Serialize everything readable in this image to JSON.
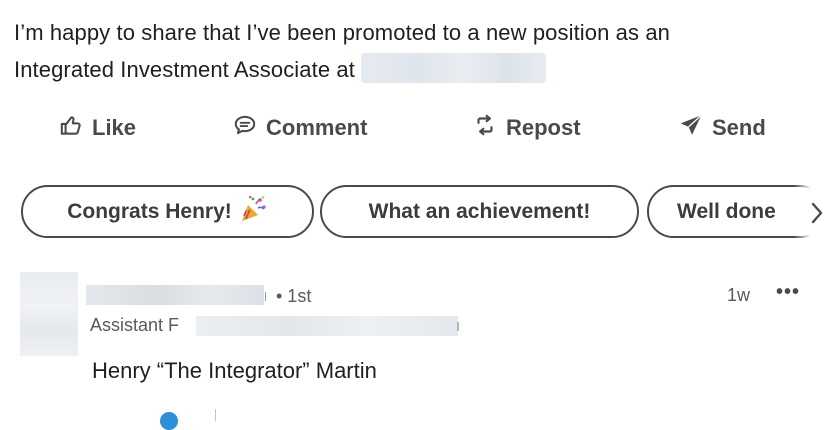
{
  "post": {
    "text_line_1": "I’m happy to share that I’ve been promoted to a new position as an",
    "text_line_2": "Integrated Investment Associate at"
  },
  "actions": {
    "like": "Like",
    "comment": "Comment",
    "repost": "Repost",
    "send": "Send"
  },
  "suggested_replies": [
    {
      "label": "Congrats Henry!",
      "icon": "party-popper-icon"
    },
    {
      "label": "What an achievement!"
    },
    {
      "label": "Well done"
    }
  ],
  "comment": {
    "degree": "• 1st",
    "headline_prefix": "Assistant F",
    "timestamp": "1w",
    "more": "•••",
    "body": "Henry “The Integrator” Martin"
  },
  "colors": {
    "text": "#1f1f1f",
    "action_text": "#4a4a4a",
    "secondary_text": "#5a5a5a",
    "chip_border": "#4a4a4a",
    "reaction_blue": "#2e8fd8"
  }
}
